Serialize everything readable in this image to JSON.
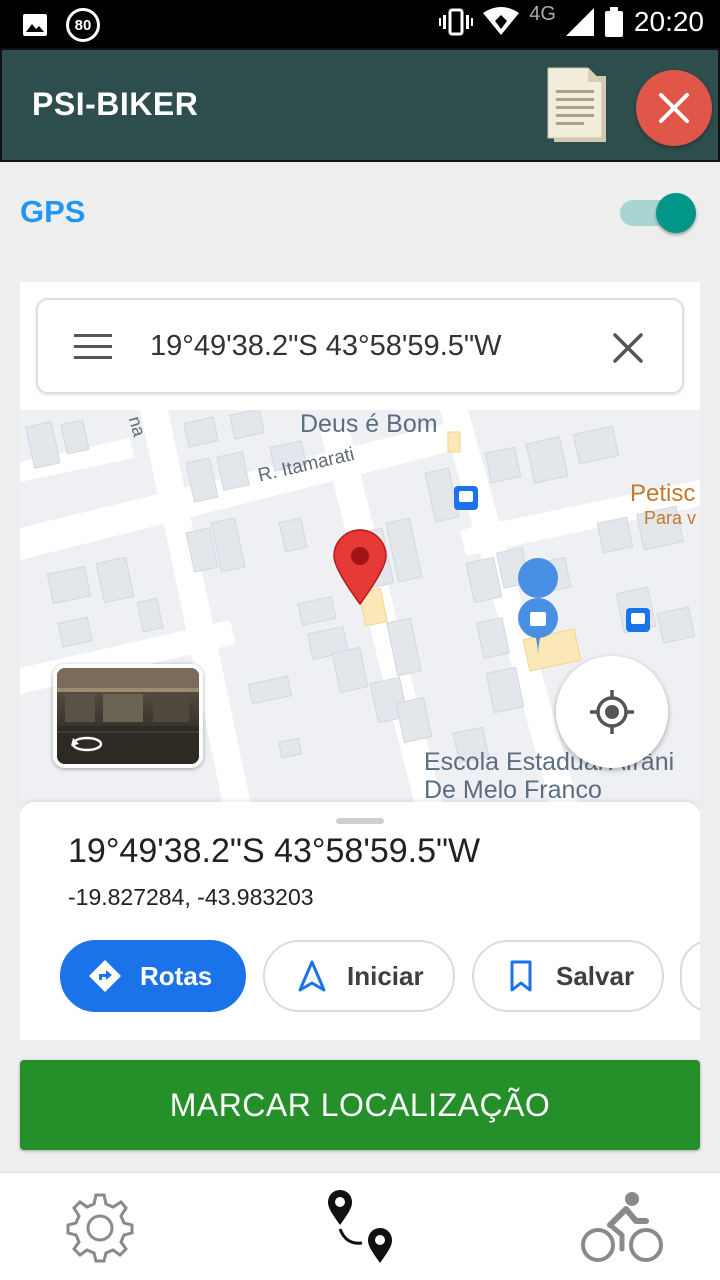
{
  "status_bar": {
    "badge": "80",
    "network": "4G",
    "time": "20:20"
  },
  "app_bar": {
    "title": "PSI-BIKER",
    "doc_icon": "document-icon",
    "close_icon": "close-icon"
  },
  "gps": {
    "label": "GPS",
    "enabled": true
  },
  "search": {
    "query": "19°49'38.2\"S 43°58'59.5\"W"
  },
  "map": {
    "labels": {
      "deus": "Deus é Bom",
      "street": "R. Itamarati",
      "na": "na",
      "petisco": "Petisc",
      "para": "Para v",
      "escola1": "Escola Estadual Afrâni",
      "escola2": "De Melo Franco"
    }
  },
  "place": {
    "title": "19°49'38.2\"S 43°58'59.5\"W",
    "decimal": "-19.827284, -43.983203"
  },
  "actions": {
    "routes": "Rotas",
    "start": "Iniciar",
    "save": "Salvar"
  },
  "mark_button": "MARCAR LOCALIZAÇÃO",
  "nav": {
    "settings_icon": "gear-icon",
    "route_icon": "route-pins-icon",
    "bike_icon": "cyclist-icon"
  }
}
